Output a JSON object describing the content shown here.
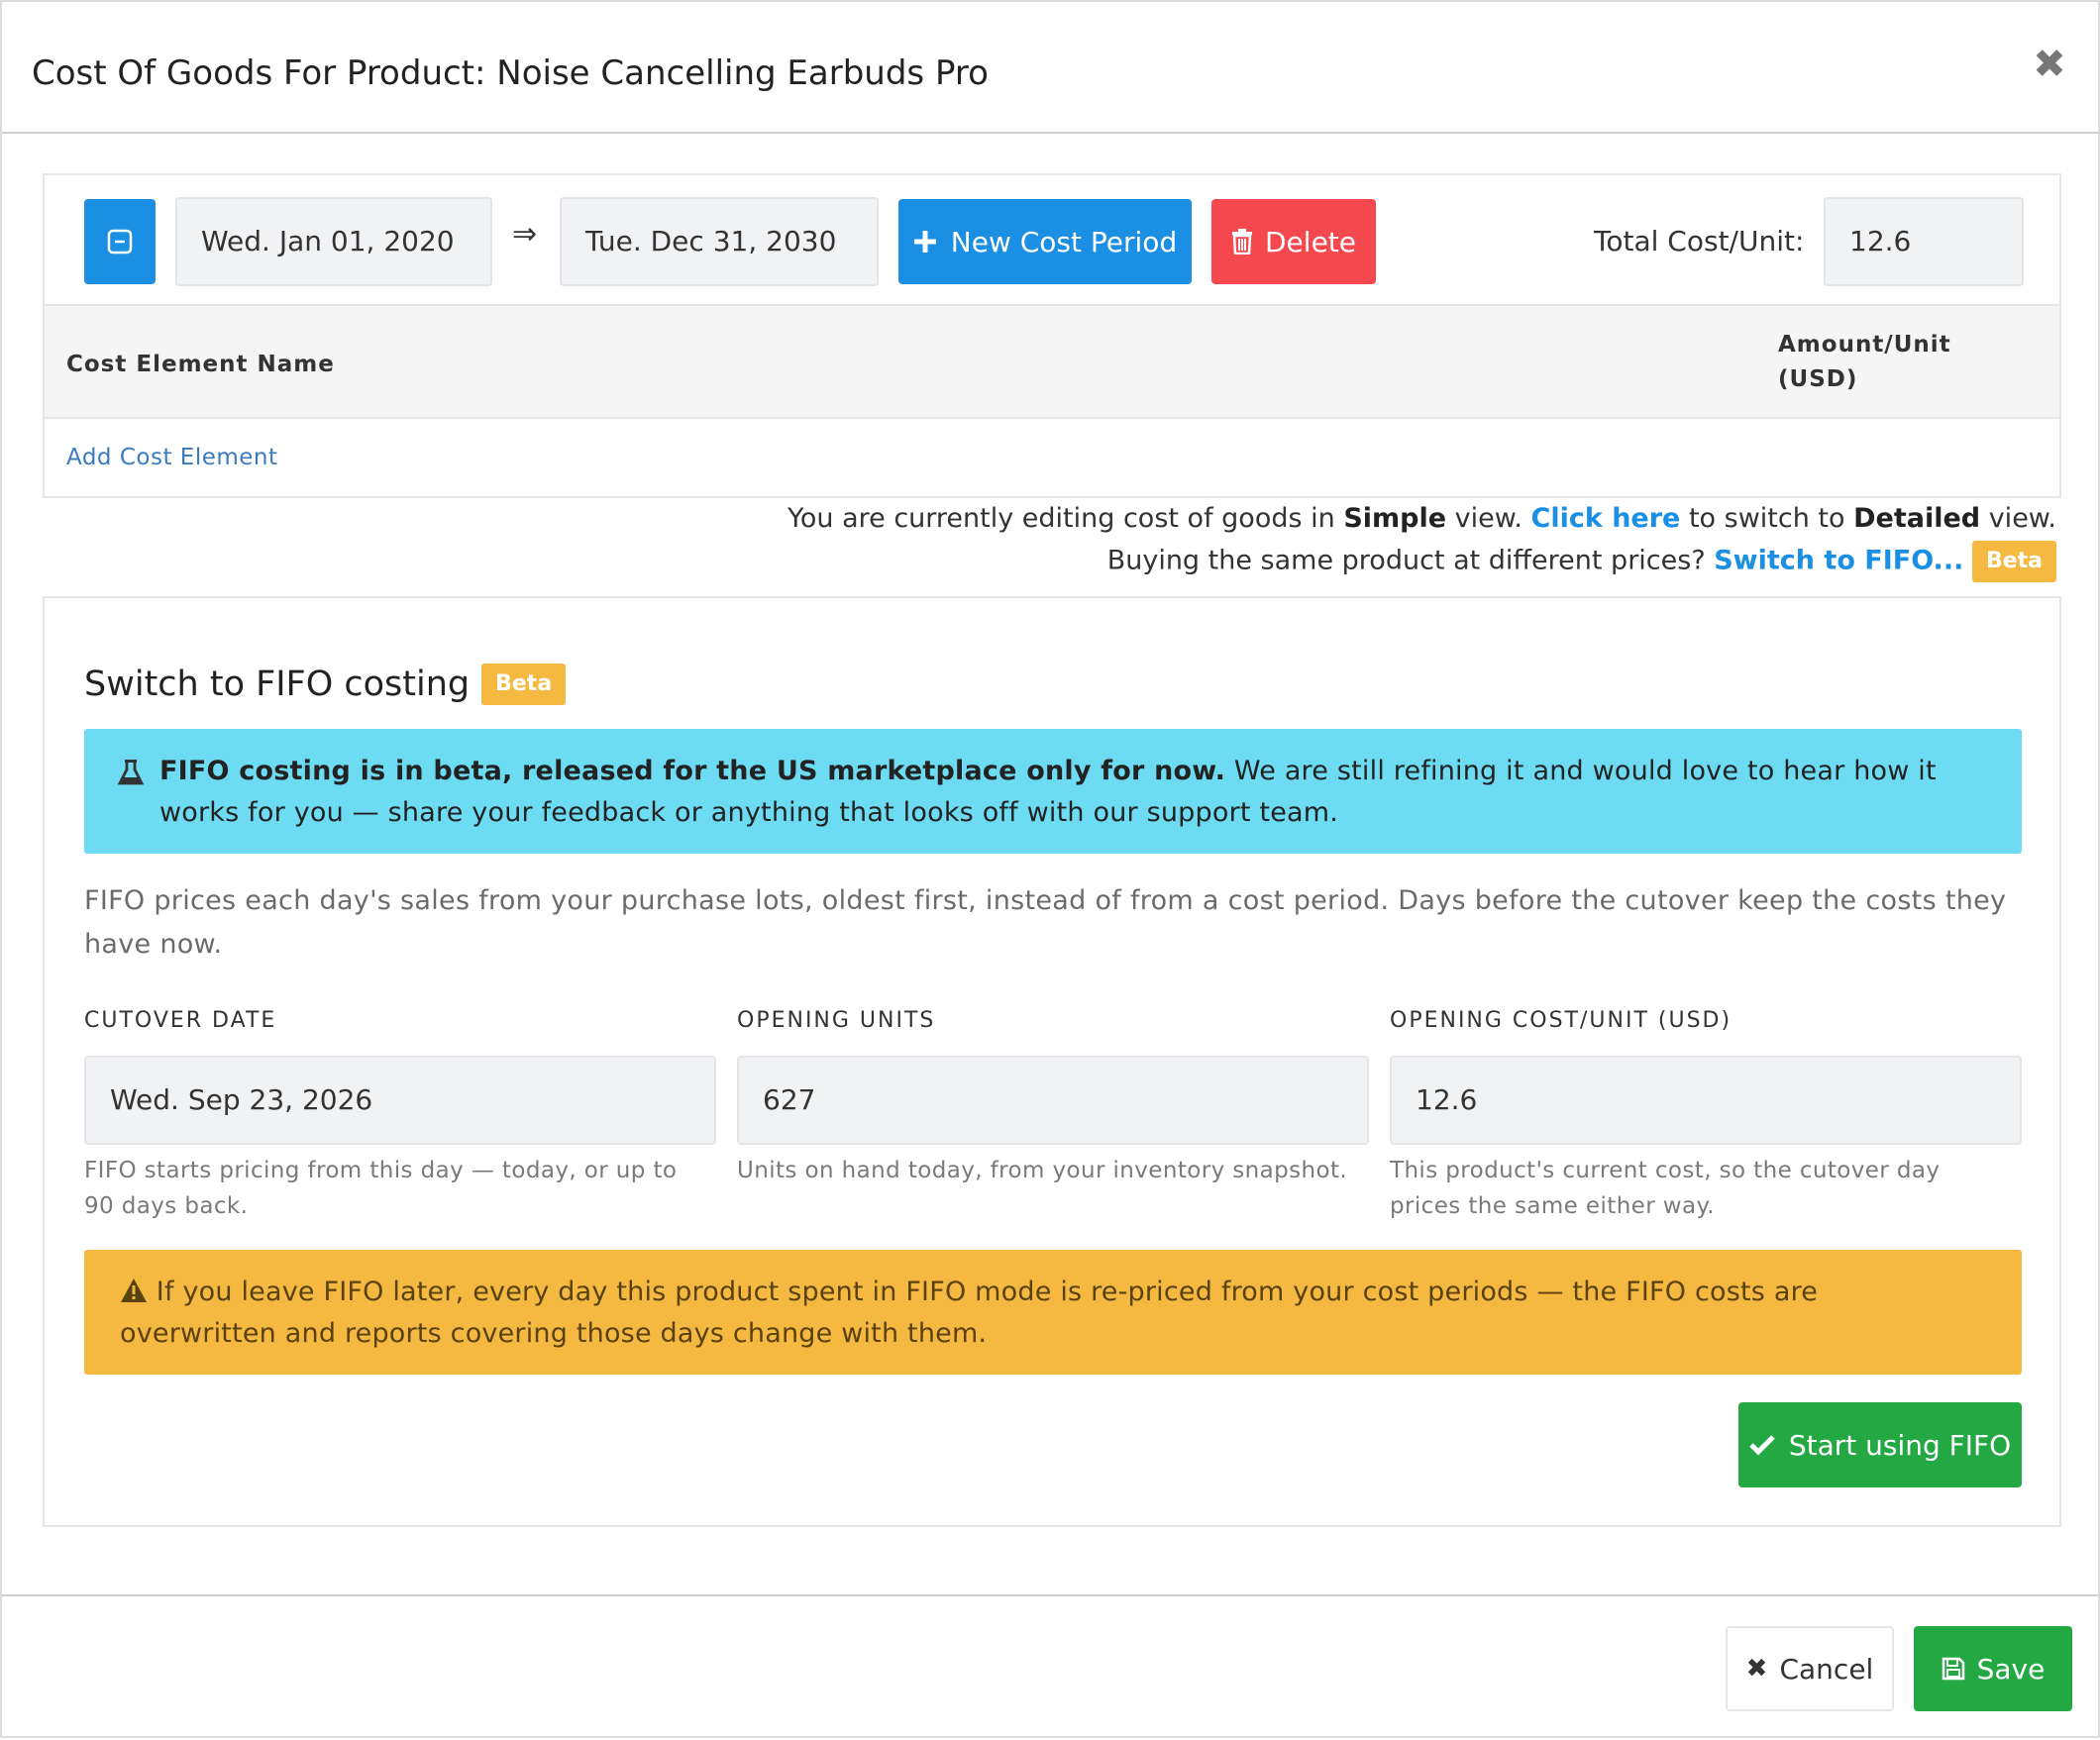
{
  "modal": {
    "title": "Cost Of Goods For Product: Noise Cancelling Earbuds Pro"
  },
  "toolbar": {
    "start_date": "Wed. Jan 01, 2020",
    "arrow": "⇒",
    "end_date": "Tue. Dec 31, 2030",
    "new_period_label": "New Cost Period",
    "delete_label": "Delete",
    "total_label": "Total Cost/Unit:",
    "total_value": "12.6"
  },
  "table": {
    "col_name": "Cost Element Name",
    "col_amount": "Amount/Unit (USD)",
    "add_link": "Add Cost Element"
  },
  "view_info": {
    "line1_a": "You are currently editing cost of goods in ",
    "line1_simple": "Simple",
    "line1_b": " view. ",
    "line1_link": "Click here",
    "line1_c": " to switch to ",
    "line1_detailed": "Detailed",
    "line1_d": " view.",
    "line2_a": "Buying the same product at different prices? ",
    "line2_link": "Switch to FIFO...",
    "beta": "Beta"
  },
  "fifo": {
    "title": "Switch to FIFO costing",
    "beta": "Beta",
    "info_bold": "FIFO costing is in beta, released for the US marketplace only for now.",
    "info_rest": " We are still refining it and would love to hear how it works for you — share your feedback or anything that looks off with our support team.",
    "description": "FIFO prices each day's sales from your purchase lots, oldest first, instead of from a cost period. Days before the cutover keep the costs they have now.",
    "fields": [
      {
        "label": "CUTOVER DATE",
        "value": "Wed. Sep 23, 2026",
        "help": "FIFO starts pricing from this day — today, or up to 90 days back."
      },
      {
        "label": "OPENING UNITS",
        "value": "627",
        "help": "Units on hand today, from your inventory snapshot."
      },
      {
        "label": "OPENING COST/UNIT (USD)",
        "value": "12.6",
        "help": "This product's current cost, so the cutover day prices the same either way."
      }
    ],
    "warning": "If you leave FIFO later, every day this product spent in FIFO mode is re-priced from your cost periods — the FIFO costs are overwritten and reports covering those days change with them.",
    "start_label": "Start using FIFO"
  },
  "footer": {
    "cancel_label": "Cancel",
    "save_label": "Save"
  },
  "colors": {
    "primary": "#1a8fe3",
    "danger": "#f6494f",
    "success": "#24a844",
    "info": "#6ddbf2",
    "warning": "#f5b942"
  },
  "icons": [
    "close-icon",
    "collapse-icon",
    "plus-icon",
    "trash-icon",
    "flask-icon",
    "warning-icon",
    "check-icon",
    "cancel-x-icon",
    "save-icon"
  ]
}
